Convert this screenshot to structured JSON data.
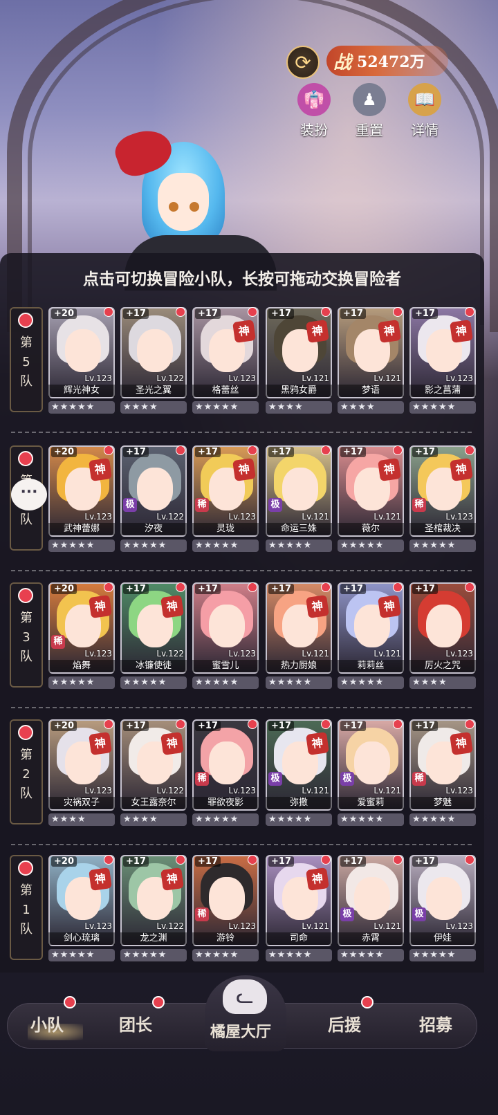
{
  "hud": {
    "swap_icon": "refresh-icon",
    "power_prefix": "战",
    "power_value": "52472万",
    "buttons": [
      {
        "label": "装扮",
        "icon": "outfit-icon",
        "color": "#c04fa8"
      },
      {
        "label": "重置",
        "icon": "reset-icon",
        "color": "#7b7e92"
      },
      {
        "label": "详情",
        "icon": "book-icon",
        "color": "#d7a24b"
      }
    ]
  },
  "panel": {
    "title": "点击可切换冒险小队，长按可拖动交换冒险者"
  },
  "teams": [
    {
      "label": "第\n5\n队",
      "cards": [
        {
          "plus": "+20",
          "level": "Lv.123",
          "name": "辉光神女",
          "rank": "",
          "god": false,
          "stars": "★★★★★",
          "hair": "#e7e2e6",
          "bg": "#a59fb0"
        },
        {
          "plus": "+17",
          "level": "Lv.122",
          "name": "圣光之翼",
          "rank": "",
          "god": false,
          "stars": "★★★★",
          "hair": "#ddd9df",
          "bg": "#9a8b7a"
        },
        {
          "plus": "+17",
          "level": "Lv.123",
          "name": "格蕾丝",
          "rank": "",
          "god": true,
          "stars": "★★★★★",
          "hair": "#e3d8db",
          "bg": "#a793a0"
        },
        {
          "plus": "+17",
          "level": "Lv.121",
          "name": "黑鸦女爵",
          "rank": "",
          "god": true,
          "stars": "★★★★",
          "hair": "#4e4637",
          "bg": "#6f6a5b"
        },
        {
          "plus": "+17",
          "level": "Lv.121",
          "name": "梦语",
          "rank": "",
          "god": true,
          "stars": "★★★★",
          "hair": "#a48668",
          "bg": "#b59b7c"
        },
        {
          "plus": "+17",
          "level": "Lv.123",
          "name": "影之菖蒲",
          "rank": "",
          "god": true,
          "stars": "★★★★★",
          "hair": "#ece7ee",
          "bg": "#8c77a3"
        }
      ]
    },
    {
      "label": "第\n4\n队",
      "cards": [
        {
          "plus": "+20",
          "level": "Lv.123",
          "name": "武神蕾娜",
          "rank": "",
          "god": true,
          "stars": "★★★★★",
          "hair": "#f2b53f",
          "bg": "#d3894a"
        },
        {
          "plus": "+17",
          "level": "Lv.122",
          "name": "汐夜",
          "rank": "极",
          "god": false,
          "stars": "★★★★★",
          "hair": "#8e9aa3",
          "bg": "#5b6170"
        },
        {
          "plus": "+17",
          "level": "Lv.123",
          "name": "灵珑",
          "rank": "稀",
          "god": true,
          "stars": "★★★★★",
          "hair": "#f1cb58",
          "bg": "#d89a56"
        },
        {
          "plus": "+17",
          "level": "Lv.121",
          "name": "命运三姝",
          "rank": "极",
          "god": false,
          "stars": "★★★★★",
          "hair": "#f3d56a",
          "bg": "#d5bf8a"
        },
        {
          "plus": "+17",
          "level": "Lv.121",
          "name": "薇尔",
          "rank": "",
          "god": true,
          "stars": "★★★★★",
          "hair": "#f6a6a4",
          "bg": "#d98c8e"
        },
        {
          "plus": "+17",
          "level": "Lv.123",
          "name": "圣棺裁决",
          "rank": "稀",
          "god": true,
          "stars": "★★★★★",
          "hair": "#f4c85a",
          "bg": "#8aa08b"
        }
      ]
    },
    {
      "label": "第\n3\n队",
      "cards": [
        {
          "plus": "+20",
          "level": "Lv.123",
          "name": "焰舞",
          "rank": "稀",
          "god": true,
          "stars": "★★★★★",
          "hair": "#f2c34f",
          "bg": "#d57b3d"
        },
        {
          "plus": "+17",
          "level": "Lv.122",
          "name": "冰镰使徒",
          "rank": "",
          "god": true,
          "stars": "★★★★★",
          "hair": "#8dd683",
          "bg": "#4f8a66"
        },
        {
          "plus": "+17",
          "level": "Lv.123",
          "name": "蜜雪儿",
          "rank": "",
          "god": false,
          "stars": "★★★★★",
          "hair": "#f59ea6",
          "bg": "#cf7e88"
        },
        {
          "plus": "+17",
          "level": "Lv.121",
          "name": "热力厨娘",
          "rank": "",
          "god": true,
          "stars": "★★★★★",
          "hair": "#f7a383",
          "bg": "#d58a66"
        },
        {
          "plus": "+17",
          "level": "Lv.121",
          "name": "莉莉丝",
          "rank": "",
          "god": true,
          "stars": "★★★★★",
          "hair": "#bcc4f2",
          "bg": "#8e93c6"
        },
        {
          "plus": "+17",
          "level": "Lv.123",
          "name": "厉火之咒",
          "rank": "",
          "god": false,
          "stars": "★★★★",
          "hair": "#d53c32",
          "bg": "#9a4c3c"
        }
      ]
    },
    {
      "label": "第\n2\n队",
      "cards": [
        {
          "plus": "+20",
          "level": "Lv.123",
          "name": "灾祸双子",
          "rank": "",
          "god": true,
          "stars": "★★★★",
          "hair": "#e5e1ea",
          "bg": "#b79b7e"
        },
        {
          "plus": "+17",
          "level": "Lv.122",
          "name": "女王露奈尔",
          "rank": "",
          "god": true,
          "stars": "★★★★",
          "hair": "#f1ebe8",
          "bg": "#a58e7a"
        },
        {
          "plus": "+17",
          "level": "Lv.123",
          "name": "罪欲夜影",
          "rank": "稀",
          "god": false,
          "stars": "★★★★★",
          "hair": "#f3a3a7",
          "bg": "#3b3840"
        },
        {
          "plus": "+17",
          "level": "Lv.121",
          "name": "弥撒",
          "rank": "极",
          "god": true,
          "stars": "★★★★★",
          "hair": "#e7e6ef",
          "bg": "#4c6a55"
        },
        {
          "plus": "+17",
          "level": "Lv.121",
          "name": "爱蜜莉",
          "rank": "极",
          "god": false,
          "stars": "★★★★★",
          "hair": "#f6d3a5",
          "bg": "#d8a9a5"
        },
        {
          "plus": "+17",
          "level": "Lv.123",
          "name": "梦魅",
          "rank": "稀",
          "god": true,
          "stars": "★★★★★",
          "hair": "#efeae8",
          "bg": "#a59585"
        }
      ]
    },
    {
      "label": "第\n1\n队",
      "cards": [
        {
          "plus": "+20",
          "level": "Lv.123",
          "name": "剑心琉璃",
          "rank": "",
          "god": true,
          "stars": "★★★★★",
          "hair": "#a9d3ea",
          "bg": "#8fb0c4"
        },
        {
          "plus": "+17",
          "level": "Lv.122",
          "name": "龙之渊",
          "rank": "",
          "god": true,
          "stars": "★★★★★",
          "hair": "#9dc6a6",
          "bg": "#6a8f76"
        },
        {
          "plus": "+17",
          "level": "Lv.123",
          "name": "游铃",
          "rank": "稀",
          "god": false,
          "stars": "★★★★★",
          "hair": "#2e2a2c",
          "bg": "#c96d45"
        },
        {
          "plus": "+17",
          "level": "Lv.121",
          "name": "司命",
          "rank": "",
          "god": true,
          "stars": "★★★★★",
          "hair": "#e7d8ee",
          "bg": "#a98fbf"
        },
        {
          "plus": "+17",
          "level": "Lv.121",
          "name": "赤霄",
          "rank": "极",
          "god": false,
          "stars": "★★★★★",
          "hair": "#f2e8e6",
          "bg": "#c9a7a0"
        },
        {
          "plus": "+17",
          "level": "Lv.123",
          "name": "伊娃",
          "rank": "极",
          "god": false,
          "stars": "★★★★★",
          "hair": "#ece8ee",
          "bg": "#b7acbd"
        }
      ]
    }
  ],
  "chat_icon": "chat-bubble-icon",
  "nav": {
    "squad": "小队",
    "leader": "团长",
    "hall": "橘屋大厅",
    "support": "后援",
    "recruit": "招募",
    "hall_icon": "cat-icon"
  },
  "colors": {
    "accent": "#e6404e",
    "panel_bg": "#181620",
    "god_badge": "#c4302e",
    "rank_rare": "#c83a4c",
    "rank_ultra": "#7a3fa8"
  }
}
